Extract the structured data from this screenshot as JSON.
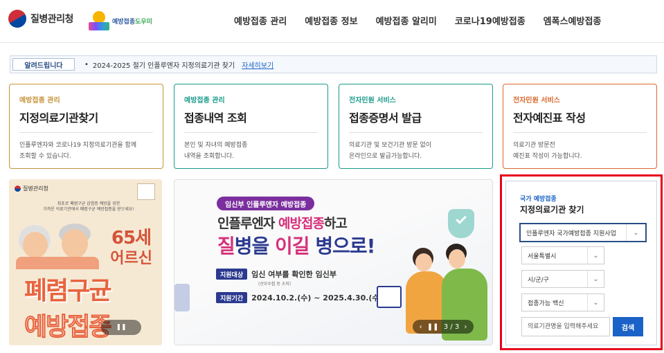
{
  "header": {
    "logo_kdca": "질병관리청",
    "logo_helper_main": "예방접종",
    "logo_helper_accent": "도우미",
    "nav": [
      "예방접종 관리",
      "예방접종 정보",
      "예방접종 알리미",
      "코로나19예방접종",
      "엠폭스예방접종"
    ]
  },
  "notice": {
    "title": "알려드립니다",
    "bullet": "•",
    "text": "2024-2025 절기 인플루엔자 지정의료기관 찾기",
    "link": "자세히보기"
  },
  "cards": [
    {
      "category": "예방접종 관리",
      "title": "지정의료기관찾기",
      "desc1": "인플루엔자와 코로나19 지정의료기관을 함께",
      "desc2": "조회할 수 있습니다.",
      "color": "#c5933a"
    },
    {
      "category": "예방접종 관리",
      "title": "접종내역 조회",
      "desc1": "본인 및 자녀의 예방접종",
      "desc2": "내역을 조회합니다.",
      "color": "#1a9b8a"
    },
    {
      "category": "전자민원 서비스",
      "title": "접종증명서 발급",
      "desc1": "의료기관 및 보건기관 방문 없이",
      "desc2": "온라인으로 발급가능합니다.",
      "color": "#1a9b8a"
    },
    {
      "category": "전자민원 서비스",
      "title": "전자예진표 작성",
      "desc1": "의료기관 방문전",
      "desc2": "예진표 작성이 가능합니다.",
      "color": "#d9682c"
    }
  ],
  "banner_left": {
    "logo": "질병관리청",
    "sub1": "최초로 폐렴구균 감염증 예방을 위한",
    "sub2": "가까운 의료기관에서 폐렴구균 예방접종을 받으세요!",
    "age": "65세",
    "elder": "어르신",
    "main1": "폐렴구균",
    "main2": "예방접종",
    "pause": "❚❚"
  },
  "banner_main": {
    "pill": "임신부 인플루엔자 예방접종",
    "line1_a": "인플루엔자 ",
    "line1_hl": "예방접종",
    "line1_b": "하고",
    "line2_a": "질",
    "line2_b": "병을 ",
    "line2_c": "이길",
    "line2_d": " 병으로!",
    "target_tag": "지원대상",
    "target_val": "임신 여부를 확인한 임신부",
    "target_note": "(산모수첩 등 소지)",
    "period_tag": "지원기간",
    "period_val": "2024.10.2.(수) ~ 2025.4.30.(수)",
    "prev": "‹",
    "pause": "❚❚",
    "page": "3 / 3",
    "next": "›"
  },
  "search": {
    "category": "국가 예방접종",
    "title": "지정의료기관 찾기",
    "program": "인플루엔자 국가예방접종 지원사업",
    "region": "서울특별시",
    "district": "시/군/구",
    "vaccine": "접종가능 백신",
    "input_placeholder": "의료기관명을 입력해주세요",
    "button": "검색"
  }
}
